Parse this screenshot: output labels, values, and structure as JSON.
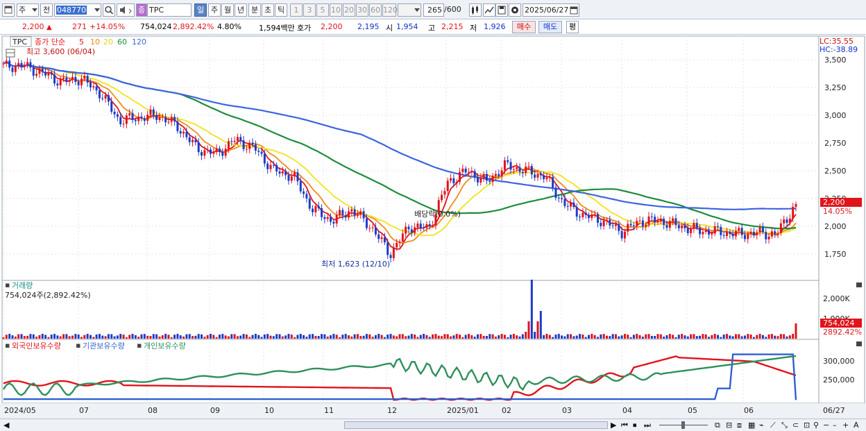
{
  "toolbar": {
    "type_label": "주",
    "prev_label": "전",
    "code": "048770",
    "stock_badge": "종",
    "stock_name": "TPC",
    "periods": [
      "일",
      "주",
      "월",
      "년",
      "분",
      "초",
      "틱"
    ],
    "intervals": [
      "1",
      "3",
      "5",
      "10",
      "20",
      "30",
      "60",
      "120"
    ],
    "count": "265",
    "count_total": "/600",
    "date": "2025/06/27"
  },
  "price": {
    "current": "2,200",
    "change": "271",
    "change_pct": "+14.05%",
    "volume": "754,024",
    "volume_pct": "2,892.42%",
    "turnover": "4.80%",
    "amount": "1,594백만",
    "quote_label": "호가",
    "ask": "2,200",
    "bid": "2,195",
    "open_label": "시",
    "open": "1,954",
    "high_label": "고",
    "high": "2,215",
    "low_label": "저",
    "low": "1,926",
    "buy_label": "매수",
    "sell_label": "매도",
    "eval_label": "평"
  },
  "price_panel": {
    "stock": "TPC",
    "ma_title": "종가 단순",
    "ma_periods": [
      "5",
      "10",
      "20",
      "60",
      "120"
    ],
    "ma_colors": [
      "#e0141b",
      "#f08a1c",
      "#f2e21a",
      "#1e8c3c",
      "#3c64e0"
    ],
    "high_note": "최고 3,600 (06/04)",
    "low_note": "최저 1,623 (12/10)",
    "dividend_note": "배당락(0.0%)",
    "lc": "LC:35.55",
    "hc": "HC:-38.89",
    "price_tag": "2,200",
    "pct_tag": "14.05%",
    "y_ticks": [
      "3,500",
      "3,250",
      "3,000",
      "2,750",
      "2,500",
      "2,250",
      "2,000",
      "1,750"
    ]
  },
  "volume_panel": {
    "title": "거래량",
    "value": "754,024주(2,892.42%)",
    "y_ticks": [
      "2,000K",
      "1,000K"
    ],
    "vol_tag": "754,024",
    "vol_pct_tag": "2892.42%"
  },
  "holding_panel": {
    "legend": [
      "외국인보유수량",
      "기관보유수량",
      "개인보유수량"
    ],
    "colors": [
      "#e0141b",
      "#2f5fd0",
      "#2f8f5a"
    ],
    "y_ticks": [
      "300,000",
      "250,000"
    ]
  },
  "x_axis": {
    "labels": [
      "2024/05",
      "07",
      "08",
      "09",
      "10",
      "11",
      "12",
      "2025/01",
      "02",
      "03",
      "04",
      "05",
      "06"
    ],
    "end_label": "06/27"
  },
  "chart_data": {
    "type": "line",
    "title": "TPC",
    "close_approx": [
      3440,
      3450,
      3380,
      3300,
      3330,
      3200,
      2950,
      2980,
      3000,
      2900,
      2700,
      2650,
      2780,
      2700,
      2500,
      2450,
      2150,
      2050,
      2150,
      2000,
      1750,
      2000,
      1980,
      2400,
      2500,
      2400,
      2550,
      2500,
      2450,
      2200,
      2100,
      2050,
      1950,
      2050,
      2050,
      2000,
      1960,
      1950,
      1930,
      1940,
      1929,
      2200
    ],
    "ma120_approx": [
      3580,
      3550,
      3480,
      3380,
      3300,
      3150,
      3050,
      2920,
      2780,
      2650,
      2530,
      2460,
      2400,
      2340,
      2280,
      2240,
      2190,
      2150,
      2140
    ],
    "price_range": [
      1623,
      3600
    ],
    "series": [
      {
        "name": "5",
        "color": "#e0141b"
      },
      {
        "name": "10",
        "color": "#f08a1c"
      },
      {
        "name": "20",
        "color": "#f2e21a"
      },
      {
        "name": "60",
        "color": "#1e8c3c"
      },
      {
        "name": "120",
        "color": "#3c64e0"
      }
    ]
  }
}
